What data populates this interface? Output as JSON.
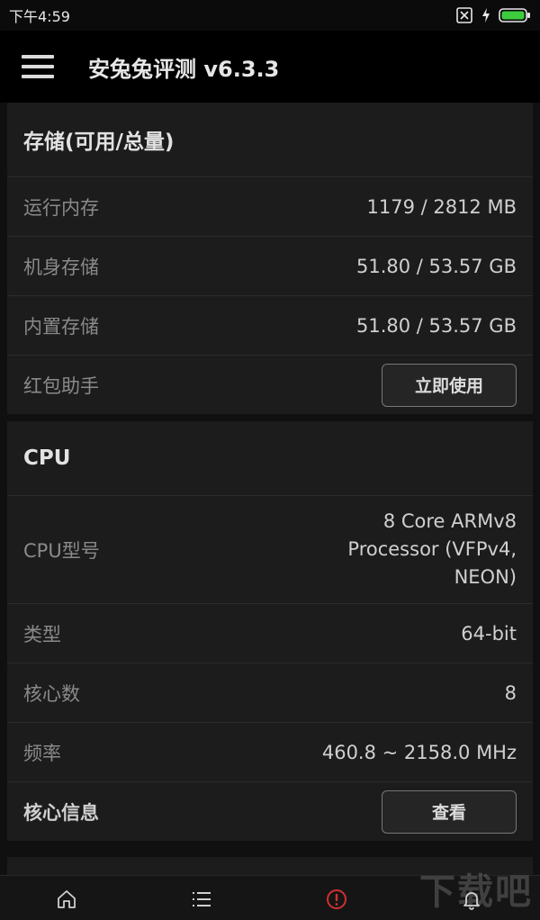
{
  "status_bar": {
    "time": "下午4:59"
  },
  "app_bar": {
    "title": "安兔兔评测 v6.3.3"
  },
  "storage": {
    "title": "存储(可用/总量)",
    "rows": [
      {
        "label": "运行内存",
        "value": "1179 / 2812 MB"
      },
      {
        "label": "机身存储",
        "value": "51.80 / 53.57 GB"
      },
      {
        "label": "内置存储",
        "value": "51.80 / 53.57 GB"
      }
    ],
    "helper_label": "红包助手",
    "helper_button": "立即使用"
  },
  "cpu": {
    "title": "CPU",
    "rows": [
      {
        "label": "CPU型号",
        "value": "8 Core ARMv8\nProcessor (VFPv4,\nNEON)"
      },
      {
        "label": "类型",
        "value": "64-bit"
      },
      {
        "label": "核心数",
        "value": "8"
      },
      {
        "label": "频率",
        "value": "460.8 ~ 2158.0 MHz"
      }
    ],
    "core_info_label": "核心信息",
    "core_info_button": "查看"
  },
  "bottom_nav": {
    "icons": [
      "home-icon",
      "list-icon",
      "alert-icon",
      "bell-icon"
    ],
    "active_color": "#d03030"
  },
  "watermark": "下载吧"
}
